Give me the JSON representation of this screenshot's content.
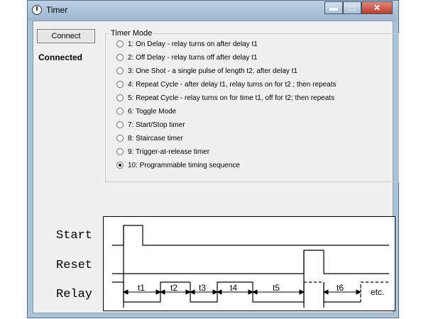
{
  "window": {
    "title": "Timer"
  },
  "caption_buttons": {
    "minimize_icon": "minimize-icon",
    "maximize_icon": "maximize-icon",
    "close_icon": "close-icon"
  },
  "connect_button": {
    "label": "Connect"
  },
  "status": {
    "text": "Connected"
  },
  "timer_mode": {
    "group_label": "Timer Mode",
    "selected": 10,
    "options": [
      {
        "label": "1: On Delay - relay turns on after delay t1",
        "checked": false
      },
      {
        "label": "2: Off Delay - relay turns off after delay t1",
        "checked": false
      },
      {
        "label": "3: One Shot - a single pulse of length t2, after delay t1",
        "checked": false
      },
      {
        "label": "4: Repeat Cycle - after delay t1, relay turns on for t2 ; then repeats",
        "checked": false
      },
      {
        "label": "5: Repeat Cycle - relay turns on for time t1, off for t2; then repeats",
        "checked": false
      },
      {
        "label": "6: Toggle Mode",
        "checked": false
      },
      {
        "label": "7: Start/Stop timer",
        "checked": false
      },
      {
        "label": "8: Staircase timer",
        "checked": false
      },
      {
        "label": "9: Trigger-at-release timer",
        "checked": false
      },
      {
        "label": "10: Programmable timing sequence",
        "checked": true
      }
    ]
  },
  "timing_diagram": {
    "signals": [
      "Start",
      "Reset",
      "Relay"
    ],
    "intervals": [
      "t1",
      "t2",
      "t3",
      "t4",
      "t5",
      "t6"
    ],
    "continuation": "etc."
  }
}
